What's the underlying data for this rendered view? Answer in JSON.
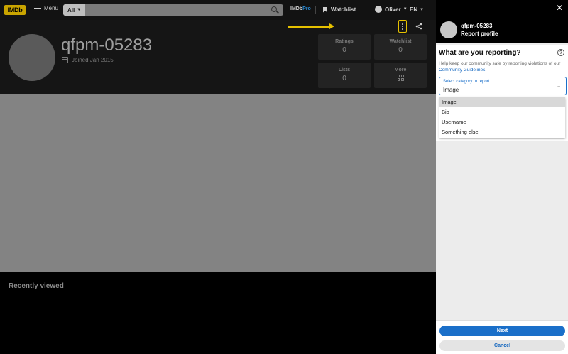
{
  "nav": {
    "logo": "IMDb",
    "menu_label": "Menu",
    "search_category": "All",
    "search_placeholder": "",
    "imdbpro_a": "IMDb",
    "imdbpro_b": "Pro",
    "watchlist_label": "Watchlist",
    "user_label": "Oliver",
    "lang_label": "EN"
  },
  "profile": {
    "username": "qfpm-05283",
    "joined": "Joined Jan 2015",
    "stats": [
      {
        "label": "Ratings",
        "value": "0"
      },
      {
        "label": "Watchlist",
        "value": "0"
      },
      {
        "label": "Lists",
        "value": "0"
      },
      {
        "label": "More",
        "value": ""
      }
    ]
  },
  "recent": {
    "heading": "Recently viewed"
  },
  "panel": {
    "username": "qfpm-05283",
    "subtitle": "Report profile",
    "question": "What are you reporting?",
    "description": "Help keep our community safe by reporting violations of our ",
    "guidelines_link": "Community Guidelines",
    "description_end": ".",
    "select_caption": "Select category to report",
    "selected": "Image",
    "options": [
      "Image",
      "Bio",
      "Username",
      "Something else"
    ],
    "next_label": "Next",
    "cancel_label": "Cancel"
  },
  "colors": {
    "accent": "#e6c100",
    "primary_button": "#1a6fc9",
    "link": "#0e63be"
  }
}
